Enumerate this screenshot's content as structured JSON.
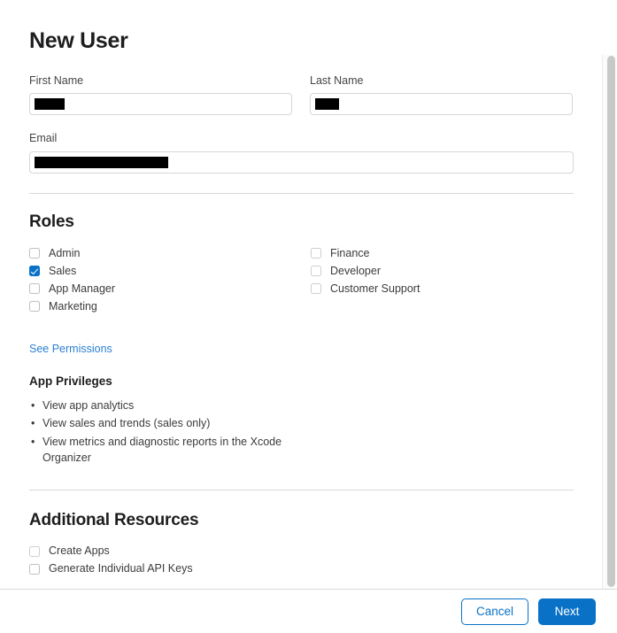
{
  "page": {
    "title": "New User"
  },
  "form": {
    "first_name": {
      "label": "First Name",
      "value": "",
      "redacted": true,
      "placeholder": ""
    },
    "last_name": {
      "label": "Last Name",
      "value": "",
      "redacted": true,
      "placeholder": ""
    },
    "email": {
      "label": "Email",
      "value": "",
      "redacted": true,
      "placeholder": ""
    }
  },
  "roles": {
    "heading": "Roles",
    "left_column": [
      {
        "label": "Admin",
        "checked": false
      },
      {
        "label": "Sales",
        "checked": true
      },
      {
        "label": "App Manager",
        "checked": false
      },
      {
        "label": "Marketing",
        "checked": false
      }
    ],
    "right_column": [
      {
        "label": "Finance",
        "checked": false
      },
      {
        "label": "Developer",
        "checked": false
      },
      {
        "label": "Customer Support",
        "checked": false
      }
    ],
    "see_permissions_link": "See Permissions"
  },
  "app_privileges": {
    "heading": "App Privileges",
    "items": [
      "View app analytics",
      "View sales and trends (sales only)",
      "View metrics and diagnostic reports in the Xcode Organizer"
    ]
  },
  "additional_resources": {
    "heading": "Additional Resources",
    "items": [
      {
        "label": "Create Apps",
        "checked": false
      },
      {
        "label": "Generate Individual API Keys",
        "checked": false
      }
    ]
  },
  "footer": {
    "cancel_label": "Cancel",
    "next_label": "Next"
  },
  "colors": {
    "accent": "#0a72c6",
    "link": "#2b7fd4",
    "divider": "#d9d9d9",
    "text": "#1d1d1f",
    "muted_text": "#3b3b3d"
  }
}
